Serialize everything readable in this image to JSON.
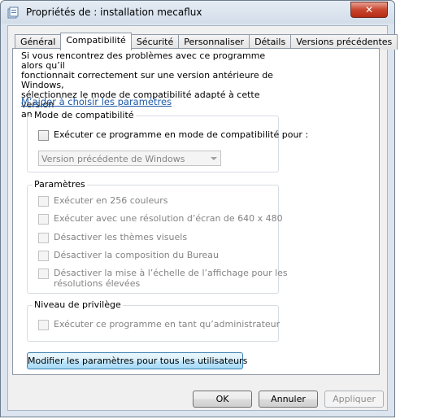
{
  "window": {
    "title": "Propriétés de : installation mecaflux",
    "close_glyph": "✕"
  },
  "tabs": [
    "Général",
    "Compatibilité",
    "Sécurité",
    "Personnaliser",
    "Détails",
    "Versions précédentes"
  ],
  "active_tab": "Compatibilité",
  "intro_lines": [
    "Si vous rencontrez des problèmes avec ce programme alors qu’il",
    "fonctionnait correctement sur une version antérieure de Windows,",
    "sélectionnez le mode de compatibilité adapté à cette version",
    "antérieure."
  ],
  "help_link": "M’aider à choisir les paramètres",
  "compat_mode": {
    "label": "Mode de compatibilité",
    "checkbox_label": "Exécuter ce programme en mode de compatibilité pour :",
    "select_value": "Version précédente de Windows"
  },
  "settings": {
    "label": "Paramètres",
    "options": [
      "Exécuter en 256 couleurs",
      "Exécuter avec une résolution d’écran de 640 x 480",
      "Désactiver les thèmes visuels",
      "Désactiver la composition du Bureau"
    ],
    "scaling_line1": "Désactiver la mise à l’échelle de l’affichage pour les",
    "scaling_line2": "résolutions élevées"
  },
  "privilege": {
    "label": "Niveau de privilège",
    "checkbox_label": "Exécuter ce programme en tant qu’administrateur"
  },
  "all_users_button": "Modifier les paramètres pour tous les utilisateurs",
  "buttons": {
    "ok": "OK",
    "cancel": "Annuler",
    "apply": "Appliquer"
  }
}
